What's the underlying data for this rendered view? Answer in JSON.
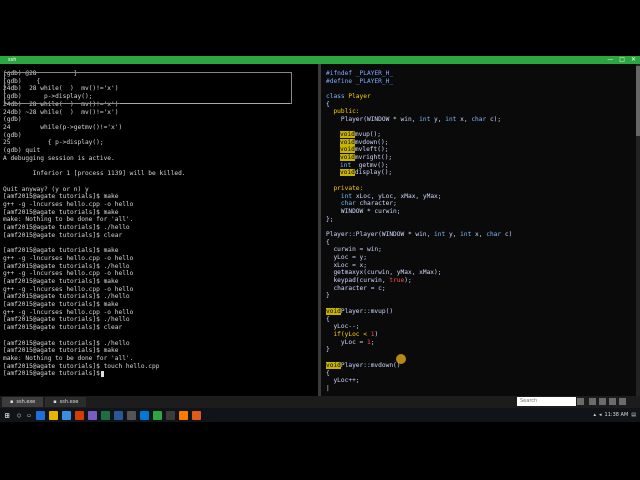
{
  "window": {
    "title": "ssh",
    "minimize": "—",
    "maximize": "□",
    "close": "✕"
  },
  "terminal_lines": [
    "(gdb) @28          }",
    "(gdb)    {",
    "24db)  28 while(  )  mv()!='x')",
    "(gdb)      p->display();",
    "24db)  28 while(  )  mv()!='x')",
    "24db) ~28 while(  )  mv()!='x')",
    "(gdb)",
    "24        while(p->getmv()!='x')",
    "(gdb)",
    "25          { p->display();",
    "(gdb) quit",
    "A debugging session is active.",
    "",
    "        Inferior 1 [process 1139] will be killed.",
    "",
    "Quit anyway? (y or n) y",
    "[amf2015@agate tutorials]$ make",
    "g++ -g -lncurses hello.cpp -o hello",
    "[amf2015@agate tutorials]$ make",
    "make: Nothing to be done for 'all'.",
    "[amf2015@agate tutorials]$ ./hello",
    "[amf2015@agate tutorials]$ clear",
    "",
    "[amf2015@agate tutorials]$ make",
    "g++ -g -lncurses hello.cpp -o hello",
    "[amf2015@agate tutorials]$ ./hello",
    "g++ -g -lncurses hello.cpp -o hello",
    "[amf2015@agate tutorials]$ make",
    "g++ -g -lncurses hello.cpp -o hello",
    "[amf2015@agate tutorials]$ ./hello",
    "[amf2015@agate tutorials]$ make",
    "g++ -g -lncurses hello.cpp -o hello",
    "[amf2015@agate tutorials]$ ./hello",
    "[amf2015@agate tutorials]$ clear",
    "",
    "[amf2015@agate tutorials]$ ./hello",
    "[amf2015@agate tutorials]$ make",
    "make: Nothing to be done for 'all'.",
    "[amf2015@agate tutorials]$ touch hello.cpp",
    "[amf2015@agate tutorials]$ "
  ],
  "code": {
    "l1a": "#ifndef ",
    "l1b": "_PLAYER_H_",
    "l2a": "#define ",
    "l2b": "_PLAYER_H_",
    "l3a": "class ",
    "l3b": "Player",
    "l4": "{",
    "l5": "  public:",
    "l6a": "    Player(WINDOW * win, ",
    "l6b": "int",
    "l6c": " y, ",
    "l6d": "int",
    "l6e": " x, ",
    "l6f": "char",
    "l6g": " c);",
    "void": "void",
    "int": "int",
    "char": "char",
    "true": "true",
    "m1": "mvup();",
    "m2": "mvdown();",
    "m3": "mvleft();",
    "m4": "mvright();",
    "m5": "  getmv();",
    "m6": "display();",
    "priv": "  private:",
    "p1a": "    ",
    "p1c": " xLoc, yLoc, xMax, yMax;",
    "p2c": " character;",
    "p3": "    WINDOW * curwin;",
    "close1": "};",
    "ctor_a": "Player::Player(WINDOW * win, ",
    "ctor_b": " y, ",
    "ctor_c": " x, ",
    "ctor_d": " c)",
    "b1": "{",
    "c1": "  curwin = win;",
    "c2": "  yLoc = y;",
    "c3": "  xLoc = x;",
    "c4": "  getmaxyx(curwin, yMax, xMax);",
    "c5a": "  keypad(curwin, ",
    "c5c": ");",
    "c6": "  character = c;",
    "b2": "}",
    "u_a": "Player::mvup()",
    "u1": "{",
    "u2": "  yLoc--;",
    "u3a": "  if(yLoc < ",
    "u3b": "1",
    "u3c": ")",
    "u4a": "    yLoc = ",
    "u4b": "1",
    "u4c": ";",
    "u5": "}",
    "d_a": "Player::mvdown()",
    "d1": "{",
    "d2": "  yLoc++;",
    "d3": "|"
  },
  "tabs": [
    {
      "label": "ssh.exe"
    },
    {
      "label": "ssh.exe"
    }
  ],
  "search": {
    "placeholder": "Search"
  },
  "clock": {
    "time": "11:38 AM"
  }
}
